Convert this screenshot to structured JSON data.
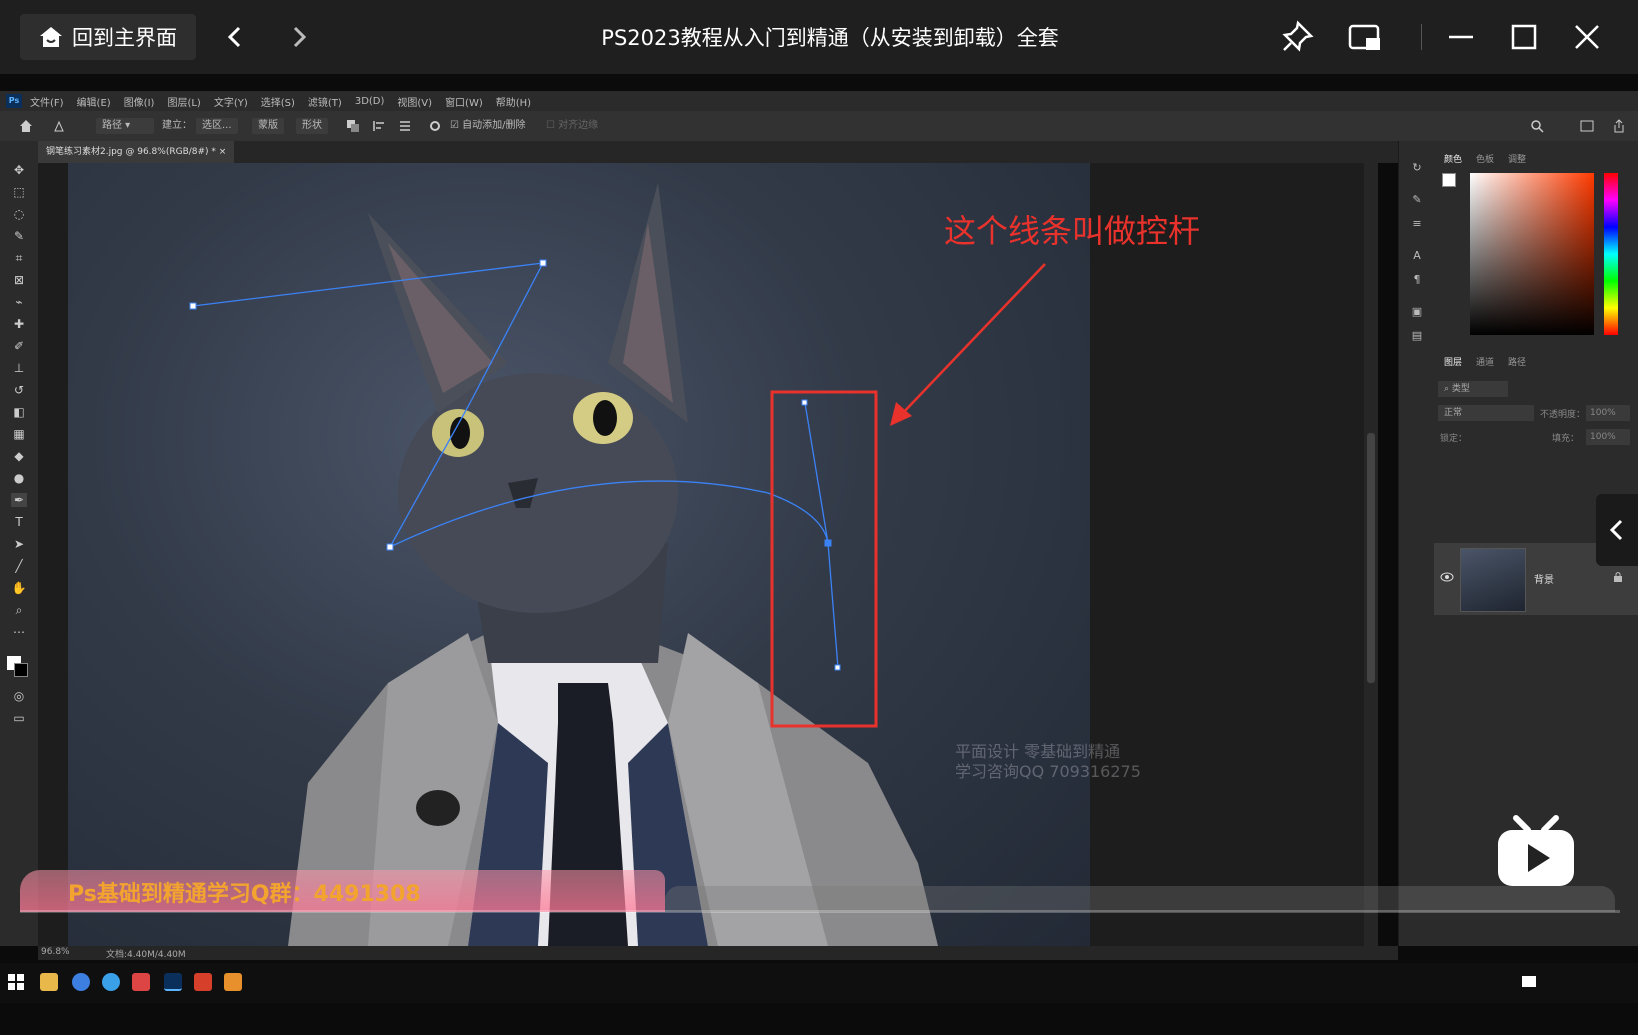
{
  "player": {
    "home_label": "回到主界面",
    "title": "PS2023教程从入门到精通（从安装到卸载）全套",
    "back_icon": "chevron-left-icon",
    "forward_icon": "chevron-right-icon"
  },
  "ps": {
    "menu": [
      "文件(F)",
      "编辑(E)",
      "图像(I)",
      "图层(L)",
      "文字(Y)",
      "选择(S)",
      "滤镜(T)",
      "3D(D)",
      "视图(V)",
      "窗口(W)",
      "帮助(H)"
    ],
    "options": {
      "mode": "路径",
      "build_label": "建立：",
      "selection": "选区...",
      "mask": "蒙版",
      "shape": "形状",
      "auto_add": "自动添加/删除",
      "align_edges": "对齐边缘"
    },
    "doc_tab": "钢笔练习素材2.jpg @ 96.8%(RGB/8#) *",
    "status": {
      "zoom": "96.8%",
      "doc": "文档:4.40M/4.40M"
    },
    "color_tabs": [
      "颜色",
      "色板",
      "调整"
    ],
    "layer_tabs": [
      "图层",
      "通道",
      "路径"
    ],
    "layers": {
      "filter": "类型",
      "blend": "正常",
      "opacity_label": "不透明度：",
      "opacity": "100%",
      "lock_label": "锁定：",
      "fill_label": "填充：",
      "fill": "100%",
      "name": "背景"
    },
    "colors": {
      "fg": "#ffffff",
      "bg": "#000000",
      "annotation": "#e8322b",
      "path": "#3b82f6"
    }
  },
  "annotation": {
    "text": "这个线条叫做控杆"
  },
  "watermark": {
    "line1": "平面设计 零基础到精通",
    "line2": "学习咨询QQ 709316275"
  },
  "banner": {
    "text": "Ps基础到精通学习Q群：4491308"
  }
}
